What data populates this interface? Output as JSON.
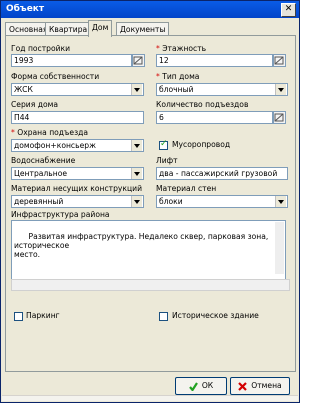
{
  "window": {
    "title": "Объект",
    "close_glyph": "✕"
  },
  "tabs": [
    {
      "label": "Основная"
    },
    {
      "label": "Квартира"
    },
    {
      "label": "Дом"
    },
    {
      "label": "Документы"
    }
  ],
  "fields": {
    "year": {
      "label": "Год постройки",
      "value": "1993"
    },
    "floors": {
      "required": "*",
      "label": "Этажность",
      "value": "12"
    },
    "ownership": {
      "label": "Форма собственности",
      "value": "ЖСК"
    },
    "house_type": {
      "required": "*",
      "label": "Тип дома",
      "value": "блочный"
    },
    "series": {
      "label": "Серия дома",
      "value": "П44"
    },
    "entrances": {
      "label": "Количество подъездов",
      "value": "6"
    },
    "security": {
      "required": "*",
      "label": "Охрана подъезда",
      "value": "домофон+консьерж"
    },
    "chute": {
      "label": "Мусоропровод",
      "checked": true
    },
    "water": {
      "label": "Водоснабжение",
      "value": "Центральное"
    },
    "lift": {
      "label": "Лифт",
      "value": "два - пассажирский грузовой"
    },
    "structure_material": {
      "label": "Материал несущих конструкций",
      "value": "деревянный"
    },
    "wall_material": {
      "label": "Материал стен",
      "value": "блоки"
    },
    "infrastructure": {
      "label": "Инфраструктура района",
      "value": "Развитая инфраструктура. Недалеко сквер, парковая зона, историческое\nместо."
    },
    "parking": {
      "label": "Паркинг",
      "checked": false
    },
    "historic": {
      "label": "Историческое здание",
      "checked": false
    }
  },
  "buttons": {
    "ok": {
      "label": "ОК",
      "icon": "check-icon"
    },
    "cancel": {
      "label": "Отмена",
      "icon": "cross-icon"
    }
  },
  "colors": {
    "title_bar": "#0a5ce6",
    "required": "#d40000",
    "ok_icon": "#21a121",
    "cancel_icon": "#d40000"
  }
}
